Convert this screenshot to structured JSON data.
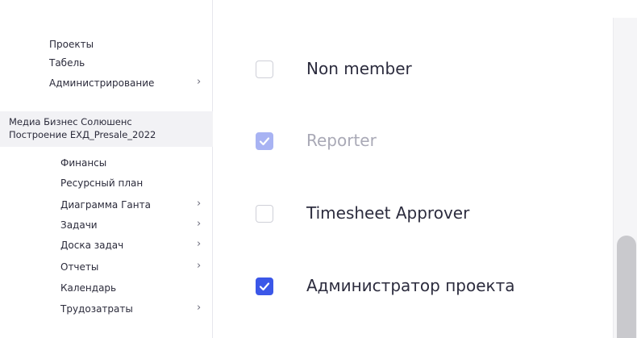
{
  "sidebar": {
    "top_items": [
      {
        "label": "Проекты",
        "has_submenu": false
      },
      {
        "label": "Табель",
        "has_submenu": false
      },
      {
        "label": "Администрирование",
        "has_submenu": true
      }
    ],
    "project": {
      "line1": "Медиа Бизнес Солюшенс",
      "line2": "Построение ЕХД_Presale_2022"
    },
    "project_items": [
      {
        "label": "Финансы",
        "has_submenu": false
      },
      {
        "label": "Ресурсный план",
        "has_submenu": false
      },
      {
        "label": "Диаграмма Ганта",
        "has_submenu": true
      },
      {
        "label": "Задачи",
        "has_submenu": true
      },
      {
        "label": "Доска задач",
        "has_submenu": true
      },
      {
        "label": "Отчеты",
        "has_submenu": true
      },
      {
        "label": "Календарь",
        "has_submenu": false
      },
      {
        "label": "Трудозатраты",
        "has_submenu": true
      }
    ],
    "chevron": "›"
  },
  "roles": [
    {
      "label": "Non member",
      "checked": false,
      "disabled": false
    },
    {
      "label": "Reporter",
      "checked": true,
      "disabled": true
    },
    {
      "label": "Timesheet Approver",
      "checked": false,
      "disabled": false
    },
    {
      "label": "Администратор проекта",
      "checked": true,
      "disabled": false
    }
  ],
  "colors": {
    "accent": "#3b57e8",
    "accent_disabled": "#a8b3f3",
    "project_highlight": "#f2f2f5"
  }
}
